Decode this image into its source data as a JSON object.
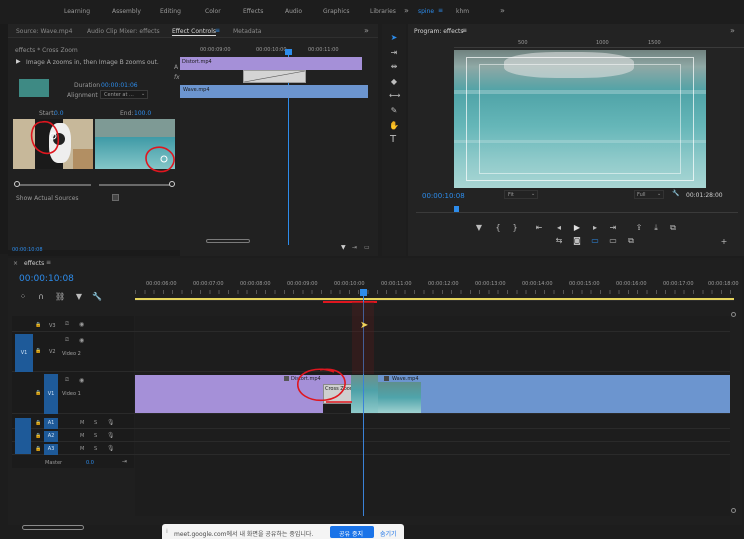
{
  "workspaces": [
    "Learning",
    "Assembly",
    "Editing",
    "Color",
    "Effects",
    "Audio",
    "Graphics",
    "Libraries"
  ],
  "active_workspace": "spine",
  "workspace_extra": "khm",
  "source_panel": {
    "tabs": [
      "Source: Wave.mp4",
      "Audio Clip Mixer: effects",
      "Effect Controls",
      "Metadata"
    ],
    "header": "effects * Cross Zoom",
    "description": "Image A zooms in, then Image B zooms out.",
    "duration_label": "Duration",
    "duration_value": "00:00:01:06",
    "alignment_label": "Alignment",
    "alignment_value": "Center at ...",
    "start_label": "Start:",
    "start_value": "0.0",
    "end_label": "End:",
    "end_value": "100.0",
    "show_actual_sources": "Show Actual Sources",
    "timecodes": [
      "00:00:09:00",
      "00:00:10:00",
      "00:00:11:00"
    ],
    "clip_a": "Distort.mp4",
    "clip_b": "Wave.mp4",
    "footer_time": "00:00:10:08",
    "side_labels": [
      "A",
      "fx"
    ]
  },
  "program_panel": {
    "title": "Program: effects",
    "ruler": [
      "500",
      "1000",
      "1500"
    ],
    "timecode": "00:00:10:08",
    "fit": "Fit",
    "quality": "Full",
    "duration": "00:01:28:00"
  },
  "timeline": {
    "tab": "effects",
    "timecode": "00:00:10:08",
    "ruler": [
      "00:00:06:00",
      "00:00:07:00",
      "00:00:08:00",
      "00:00:09:00",
      "00:00:10:00",
      "00:00:11:00",
      "00:00:12:00",
      "00:00:13:00",
      "00:00:14:00",
      "00:00:15:00",
      "00:00:16:00",
      "00:00:17:00",
      "00:00:18:00"
    ],
    "video_tracks": [
      {
        "id": "V3",
        "name": ""
      },
      {
        "id": "V2",
        "name": "Video 2"
      },
      {
        "id": "V1",
        "name": "Video 1"
      }
    ],
    "audio_tracks": [
      "A1",
      "A2",
      "A3"
    ],
    "master_label": "Master",
    "master_value": "0.0",
    "clips": {
      "distort": "Distort.mp4",
      "transition": "Cross Zoom",
      "wave": "Wave.mp4"
    }
  },
  "notification": {
    "text": "meet.google.com에서 내 화면을 공유하는 중입니다.",
    "stop_button": "공유 중지",
    "hide_button": "숨기기"
  },
  "colors": {
    "accent": "#2d8ceb",
    "clip_purple": "#a590d8",
    "clip_blue": "#6c95cf",
    "track_target": "#1e5a99",
    "annotation_red": "#e0161f"
  },
  "icons": [
    "selection-tool-icon",
    "track-select-icon",
    "ripple-edit-icon",
    "razor-icon",
    "slip-icon",
    "pen-icon",
    "hand-icon",
    "type-icon",
    "wrench-icon",
    "play-icon",
    "camera-icon",
    "lock-icon",
    "eye-icon",
    "mic-icon"
  ]
}
